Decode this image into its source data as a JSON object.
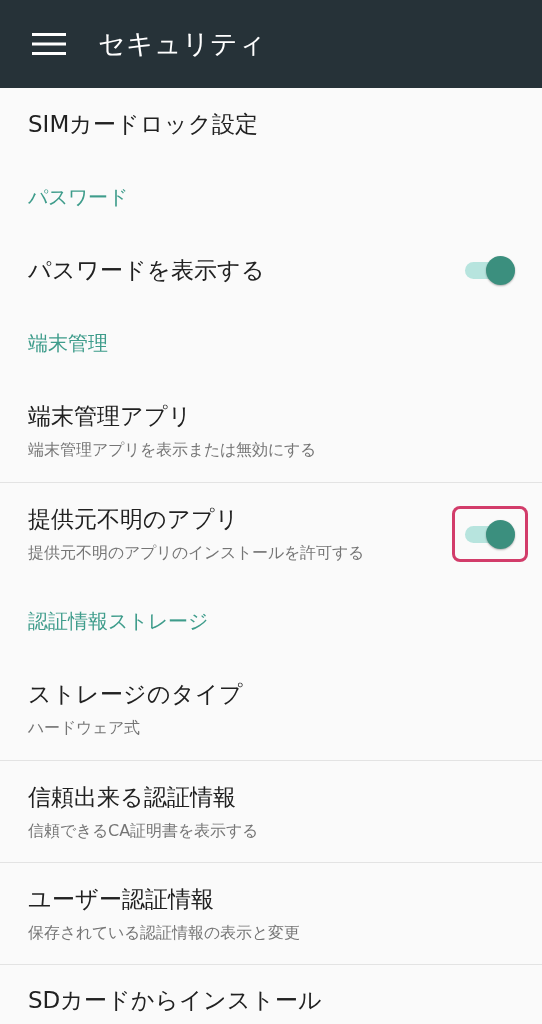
{
  "app_bar": {
    "title": "セキュリティ"
  },
  "items": [
    {
      "kind": "item",
      "title": "SIMカードロック設定"
    },
    {
      "kind": "header",
      "title": "パスワード"
    },
    {
      "kind": "item",
      "title": "パスワードを表示する",
      "toggle": {
        "on": true,
        "highlighted": false
      }
    },
    {
      "kind": "header",
      "title": "端末管理"
    },
    {
      "kind": "item",
      "title": "端末管理アプリ",
      "summary": "端末管理アプリを表示または無効にする"
    },
    {
      "kind": "item",
      "title": "提供元不明のアプリ",
      "summary": "提供元不明のアプリのインストールを許可する",
      "toggle": {
        "on": true,
        "highlighted": true
      }
    },
    {
      "kind": "header",
      "title": "認証情報ストレージ"
    },
    {
      "kind": "item",
      "title": "ストレージのタイプ",
      "summary": "ハードウェア式"
    },
    {
      "kind": "item",
      "title": "信頼出来る認証情報",
      "summary": "信頼できるCA証明書を表示する"
    },
    {
      "kind": "item",
      "title": "ユーザー認証情報",
      "summary": "保存されている認証情報の表示と変更"
    },
    {
      "kind": "item",
      "title": "SDカードからインストール"
    }
  ]
}
